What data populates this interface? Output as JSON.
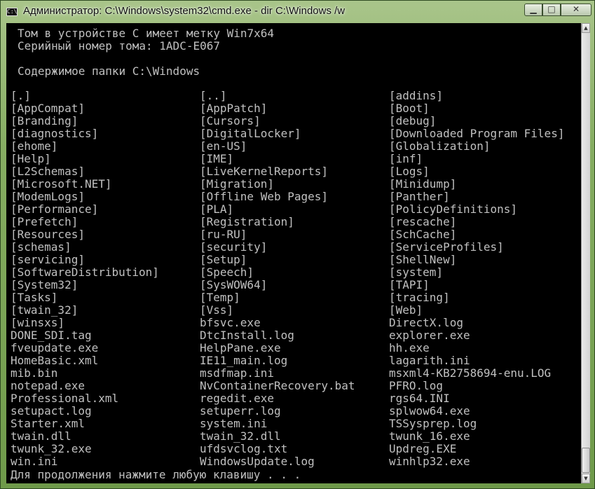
{
  "window": {
    "title": "Администратор: C:\\Windows\\system32\\cmd.exe - dir  C:\\Windows /w",
    "icon_text": "C:\\",
    "controls": {
      "minimize": "▁",
      "maximize": "□",
      "close": "✕"
    }
  },
  "console": {
    "volume_line": "Том в устройстве C имеет метку Win7x64",
    "serial_line": "Серийный номер тома: 1ADC-E067",
    "folder_line": "Содержимое папки C:\\Windows",
    "columns": [
      [
        "[.]",
        "[AppCompat]",
        "[Branding]",
        "[diagnostics]",
        "[ehome]",
        "[Help]",
        "[L2Schemas]",
        "[Microsoft.NET]",
        "[ModemLogs]",
        "[Performance]",
        "[Prefetch]",
        "[Resources]",
        "[schemas]",
        "[servicing]",
        "[SoftwareDistribution]",
        "[System32]",
        "[Tasks]",
        "[twain_32]",
        "[winsxs]",
        "DONE_SDI.tag",
        "fveupdate.exe",
        "HomeBasic.xml",
        "mib.bin",
        "notepad.exe",
        "Professional.xml",
        "setupact.log",
        "Starter.xml",
        "twain.dll",
        "twunk_32.exe",
        "win.ini"
      ],
      [
        "[..]",
        "[AppPatch]",
        "[Cursors]",
        "[DigitalLocker]",
        "[en-US]",
        "[IME]",
        "[LiveKernelReports]",
        "[Migration]",
        "[Offline Web Pages]",
        "[PLA]",
        "[Registration]",
        "[ru-RU]",
        "[security]",
        "[Setup]",
        "[Speech]",
        "[SysWOW64]",
        "[Temp]",
        "[Vss]",
        "bfsvc.exe",
        "DtcInstall.log",
        "HelpPane.exe",
        "IE11_main.log",
        "msdfmap.ini",
        "NvContainerRecovery.bat",
        "regedit.exe",
        "setuperr.log",
        "system.ini",
        "twain_32.dll",
        "ufdsvclog.txt",
        "WindowsUpdate.log"
      ],
      [
        "[addins]",
        "[Boot]",
        "[debug]",
        "[Downloaded Program Files]",
        "[Globalization]",
        "[inf]",
        "[Logs]",
        "[Minidump]",
        "[Panther]",
        "[PolicyDefinitions]",
        "[rescache]",
        "[SchCache]",
        "[ServiceProfiles]",
        "[ShellNew]",
        "[system]",
        "[TAPI]",
        "[tracing]",
        "[Web]",
        "DirectX.log",
        "explorer.exe",
        "hh.exe",
        "lagarith.ini",
        "msxml4-KB2758694-enu.LOG",
        "PFRO.log",
        "rgs64.INI",
        "splwow64.exe",
        "TSSysprep.log",
        "twunk_16.exe",
        "Updreg.EXE",
        "winhlp32.exe"
      ]
    ],
    "prompt": "Для продолжения нажмите любую клавишу . . ."
  },
  "scrollbar": {
    "up": "▲",
    "down": "▼"
  }
}
